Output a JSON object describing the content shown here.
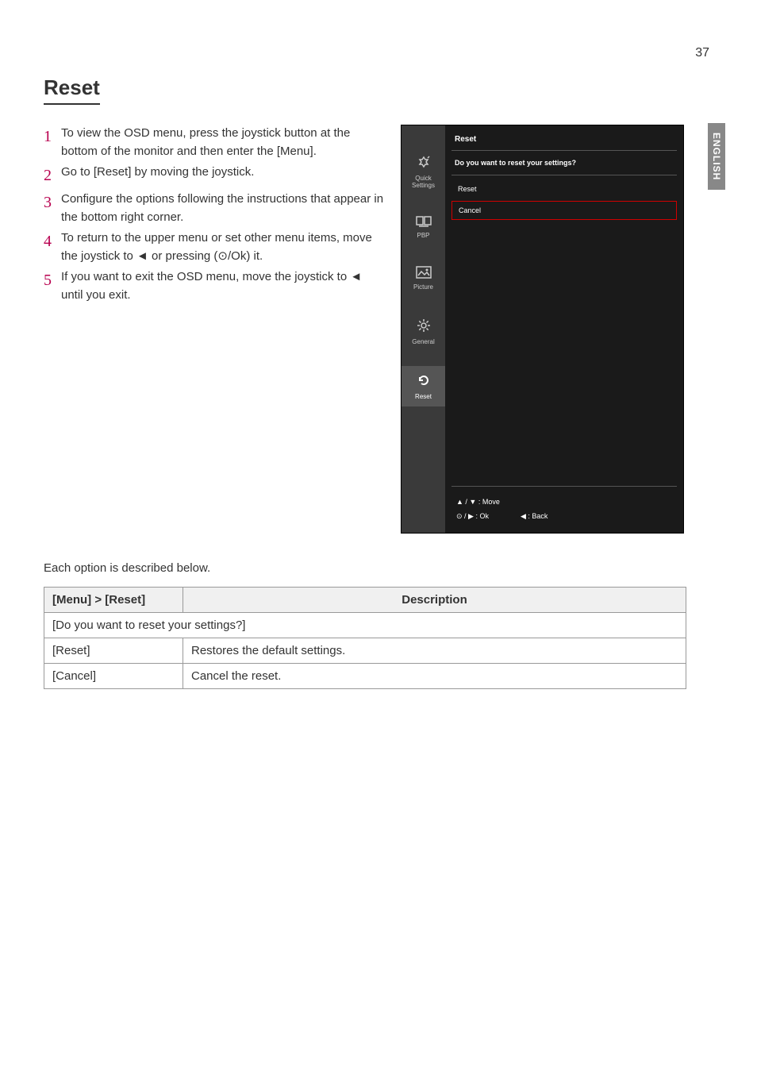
{
  "page_number": "37",
  "language_tab": "ENGLISH",
  "section_title": "Reset",
  "steps": [
    "To view the OSD menu, press the joystick button at the bottom of the monitor and then enter the [Menu].",
    "Go to [Reset] by moving the joystick.",
    "Configure the options following the instructions that appear in the bottom right corner.",
    "To return to the upper menu or set other menu items, move the joystick to ◄ or pressing (⊙/Ok) it.",
    "If you want to exit the OSD menu, move the joystick to ◄ until you exit."
  ],
  "osd": {
    "title": "Reset",
    "prompt": "Do you want to reset your settings?",
    "option_reset": "Reset",
    "option_cancel": "Cancel",
    "tabs": {
      "quick": "Quick Settings",
      "pbp": "PBP",
      "picture": "Picture",
      "general": "General",
      "reset": "Reset"
    },
    "footer": {
      "move": "▲ / ▼ : Move",
      "ok": "⊙ / ▶ : Ok",
      "back": "◀ : Back"
    }
  },
  "desc_intro": "Each option is described below.",
  "table": {
    "header_col1": "[Menu] > [Reset]",
    "header_col2": "Description",
    "row_prompt": "[Do you want to reset your settings?]",
    "row_reset_label": "[Reset]",
    "row_reset_desc": "Restores the default settings.",
    "row_cancel_label": "[Cancel]",
    "row_cancel_desc": "Cancel the reset."
  }
}
